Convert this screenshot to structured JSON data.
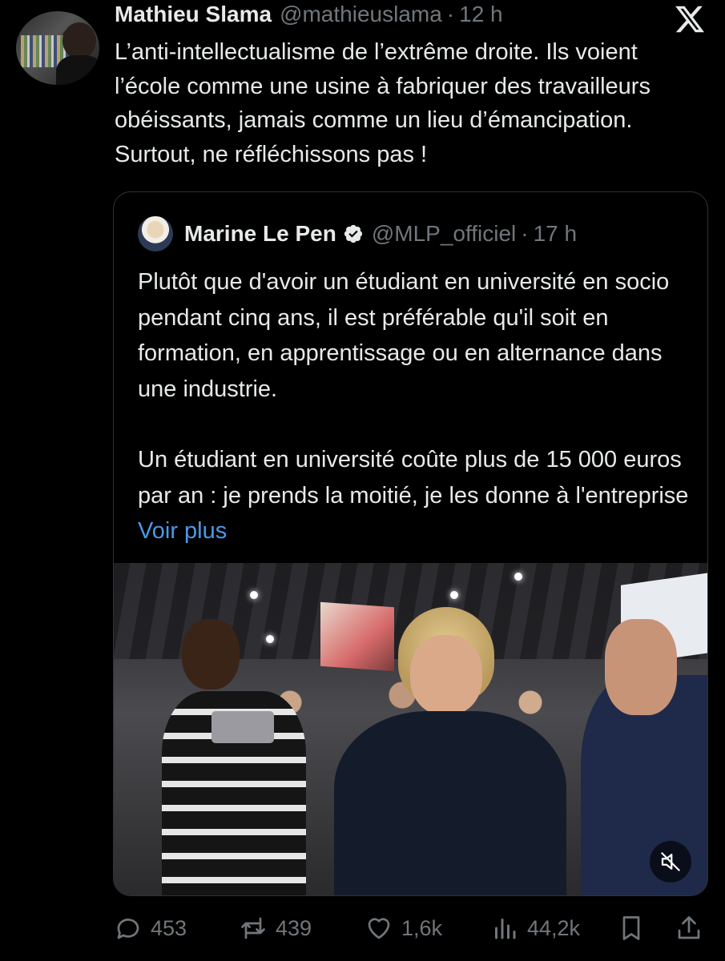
{
  "tweet": {
    "author_name": "Mathieu Slama",
    "author_handle": "@mathieuslama",
    "separator": "·",
    "time": "12 h",
    "text": "L’anti-intellectualisme de l’extrême droite. Ils voient l’école comme une usine à fabriquer des travailleurs obéissants, jamais comme un lieu d’émancipation. Surtout, ne réfléchissons pas !"
  },
  "quote": {
    "author_name": "Marine Le Pen",
    "author_handle": "@MLP_officiel",
    "separator": "·",
    "time": "17 h",
    "paragraph1": "Plutôt que d'avoir un étudiant en université en socio pendant cinq ans, il est préférable qu'il soit en formation, en apprentissage ou en alternance dans une industrie.",
    "paragraph2": "Un étudiant en université coûte plus de 15 000 euros par an : je prends la moitié, je les donne à l'entreprise",
    "more_link": "Voir plus"
  },
  "actions": {
    "replies": "453",
    "reposts": "439",
    "likes": "1,6k",
    "views": "44,2k"
  },
  "icons": {
    "logo": "x-logo-icon",
    "verified": "verified-badge-icon",
    "mute": "volume-muted-icon",
    "reply": "reply-icon",
    "repost": "repost-icon",
    "like": "heart-icon",
    "views": "views-chart-icon",
    "bookmark": "bookmark-icon",
    "share": "share-icon"
  },
  "colors": {
    "background": "#000000",
    "text": "#e7e9ea",
    "muted": "#71767b",
    "link": "#4a99e9",
    "border": "#2f3336"
  }
}
